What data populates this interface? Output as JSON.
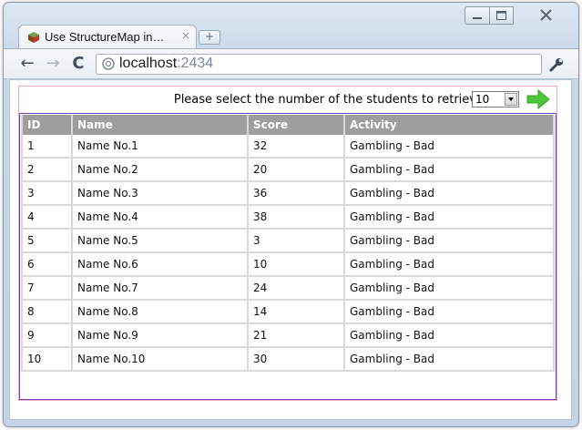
{
  "browser": {
    "tab_title": "Use StructureMap in…",
    "tab_close": "×",
    "new_tab": "+",
    "url_host": "localhost",
    "url_port": ":2434"
  },
  "page": {
    "selector_label": "Please select the number of the students to retrieve",
    "selected_count": "10",
    "accent_color": "#4ac73a"
  },
  "table": {
    "headers": [
      "ID",
      "Name",
      "Score",
      "Activity"
    ],
    "rows": [
      {
        "id": "1",
        "name": "Name No.1",
        "score": "32",
        "activity": "Gambling - Bad"
      },
      {
        "id": "2",
        "name": "Name No.2",
        "score": "20",
        "activity": "Gambling - Bad"
      },
      {
        "id": "3",
        "name": "Name No.3",
        "score": "36",
        "activity": "Gambling - Bad"
      },
      {
        "id": "4",
        "name": "Name No.4",
        "score": "38",
        "activity": "Gambling - Bad"
      },
      {
        "id": "5",
        "name": "Name No.5",
        "score": "3",
        "activity": "Gambling - Bad"
      },
      {
        "id": "6",
        "name": "Name No.6",
        "score": "10",
        "activity": "Gambling - Bad"
      },
      {
        "id": "7",
        "name": "Name No.7",
        "score": "24",
        "activity": "Gambling - Bad"
      },
      {
        "id": "8",
        "name": "Name No.8",
        "score": "14",
        "activity": "Gambling - Bad"
      },
      {
        "id": "9",
        "name": "Name No.9",
        "score": "21",
        "activity": "Gambling - Bad"
      },
      {
        "id": "10",
        "name": "Name No.10",
        "score": "30",
        "activity": "Gambling - Bad"
      }
    ]
  }
}
